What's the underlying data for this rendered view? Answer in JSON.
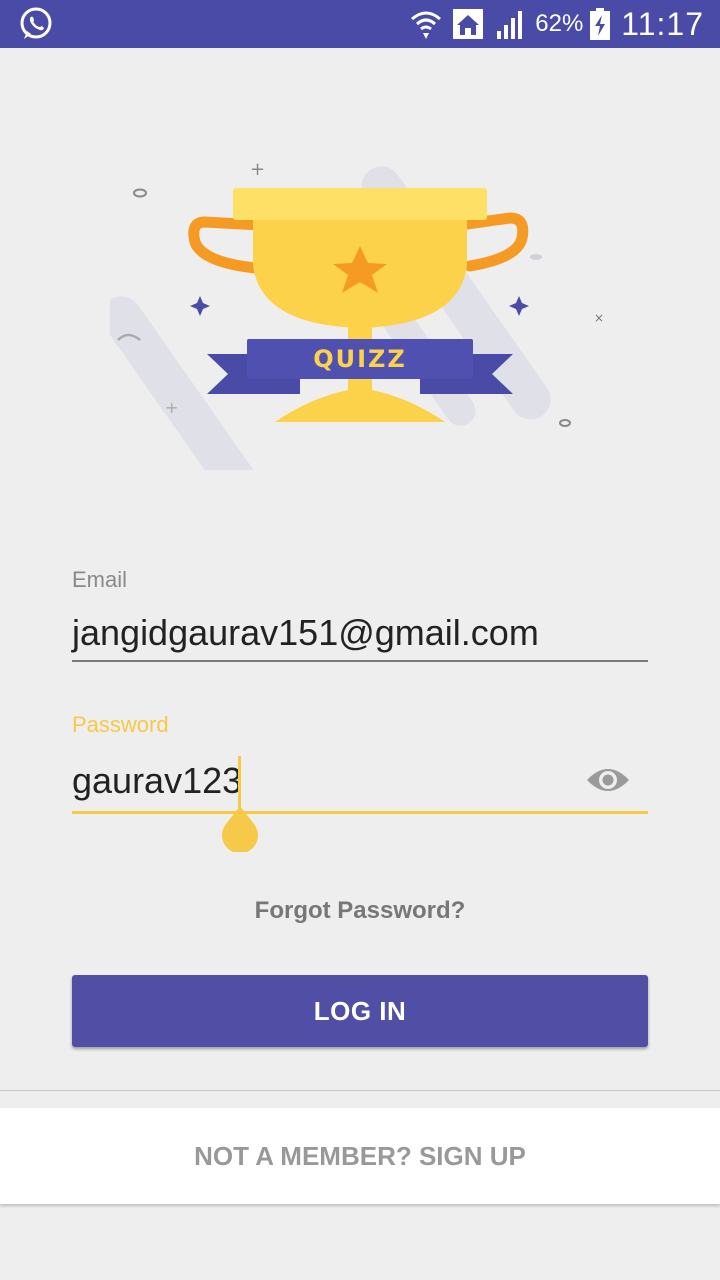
{
  "status_bar": {
    "battery_percent": "62%",
    "time": "11:17",
    "icons": [
      "whatsapp-icon",
      "wifi-icon",
      "home-icon",
      "signal-icon",
      "battery-charging-icon"
    ]
  },
  "hero": {
    "ribbon_text": "QUIZZ"
  },
  "form": {
    "email_label": "Email",
    "email_value": "jangidgaurav151@gmail.com",
    "password_label": "Password",
    "password_value": "gaurav123",
    "forgot_password": "Forgot Password?",
    "login_button": "LOG IN"
  },
  "footer": {
    "signup_text": "NOT A MEMBER? SIGN UP"
  },
  "colors": {
    "status_bar": "#4a4ba6",
    "primary": "#514ea5",
    "accent": "#f7c948",
    "background": "#eeeeee"
  }
}
